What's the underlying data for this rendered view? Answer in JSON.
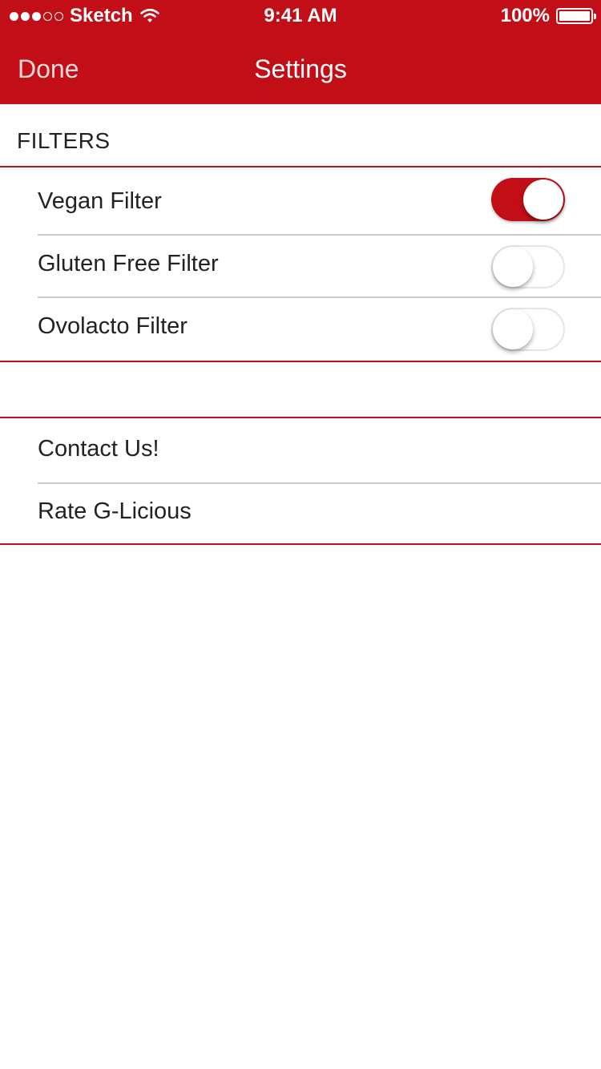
{
  "status_bar": {
    "carrier": "Sketch",
    "time": "9:41 AM",
    "battery_percent": "100%"
  },
  "nav": {
    "done_label": "Done",
    "title": "Settings"
  },
  "filters": {
    "header": "FILTERS",
    "items": [
      {
        "label": "Vegan Filter",
        "enabled": true
      },
      {
        "label": "Gluten Free Filter",
        "enabled": false
      },
      {
        "label": "Ovolacto Filter",
        "enabled": false
      }
    ]
  },
  "links": {
    "items": [
      {
        "label": "Contact Us!"
      },
      {
        "label": "Rate G-Licious"
      }
    ]
  },
  "colors": {
    "accent": "#C20E16",
    "separator": "#C9C9C9",
    "text": "#222222"
  },
  "icons": {
    "signal": "signal-dots-icon",
    "wifi": "wifi-icon",
    "battery": "battery-icon"
  }
}
